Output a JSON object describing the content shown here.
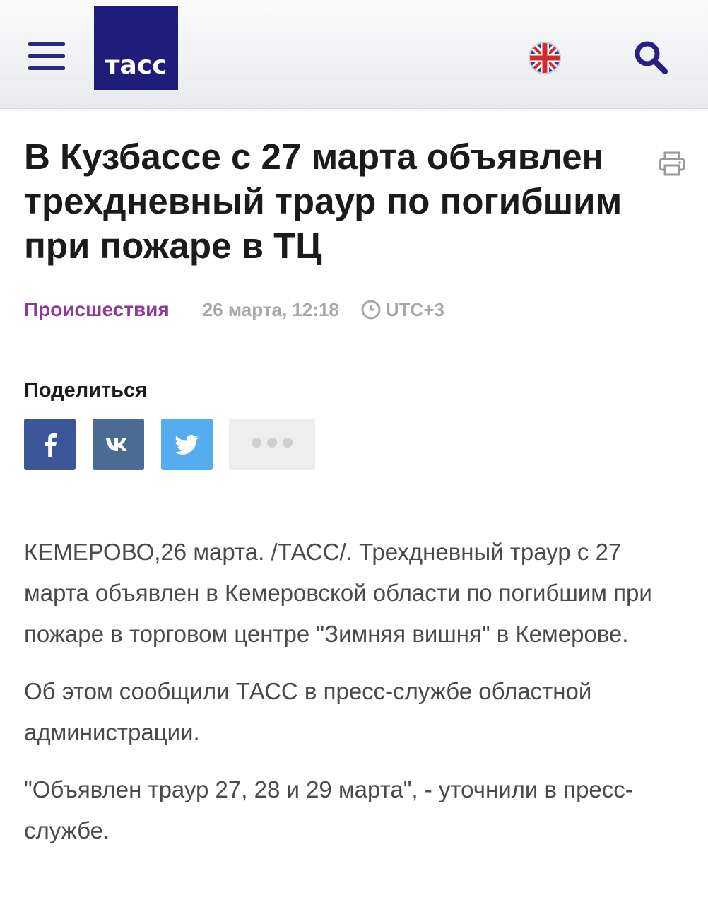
{
  "header": {
    "logo_text": "тасс",
    "menu_icon": "hamburger-menu-icon",
    "language_icon": "uk-flag-icon",
    "search_icon": "search-icon",
    "brand_color": "#1f1d7a"
  },
  "article": {
    "title": "В Кузбассе с 27 марта объявлен трехдневный траур по погибшим при пожаре в ТЦ",
    "print_icon": "printer-icon",
    "category": "Происшествия",
    "date": "26 марта, 12:18",
    "timezone": "UTC+3",
    "category_color": "#8b3a96",
    "paragraphs": [
      "КЕМЕРОВО,26 марта. /ТАСС/. Трехдневный траур с 27 марта объявлен в Кемеровской области по погибшим при пожаре в торговом центре \"Зимняя вишня\" в Кемерове.",
      "Об этом сообщили ТАСС в пресс-службе областной администрации.",
      "\"Объявлен траур 27, 28 и 29 марта\", - уточнили в пресс-службе."
    ]
  },
  "share": {
    "label": "Поделиться",
    "buttons": [
      {
        "network": "facebook",
        "icon": "facebook-icon",
        "color": "#3b5698"
      },
      {
        "network": "vkontakte",
        "icon": "vk-icon",
        "color": "#4a6c93"
      },
      {
        "network": "twitter",
        "icon": "twitter-icon",
        "color": "#55acee"
      },
      {
        "network": "more",
        "icon": "more-dots-icon",
        "color": "#eeeeee"
      }
    ]
  }
}
